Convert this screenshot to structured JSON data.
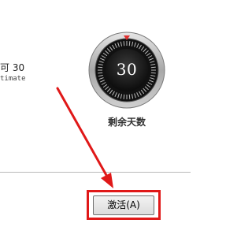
{
  "info": {
    "line1": "可 30",
    "line2": "timate"
  },
  "dial": {
    "days_remaining": "30",
    "label": "剩余天数"
  },
  "footer": {
    "activate_label": "激活(A)"
  },
  "colors": {
    "annotation_red": "#e01818",
    "dial_face": "#1a1a1a",
    "dial_marker": "#e03030"
  }
}
